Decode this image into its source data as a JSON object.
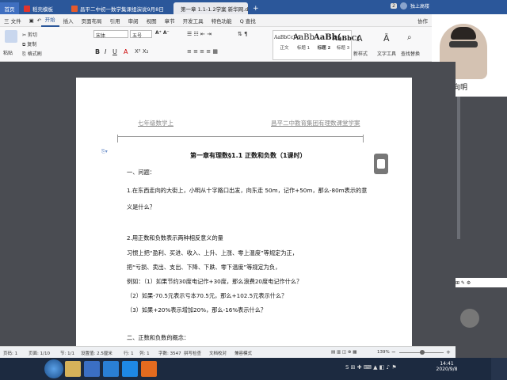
{
  "tabs": {
    "home": "首页",
    "template": "稻壳模板",
    "pdf": "昌平二中初一数学集课组演说9月8日",
    "doc": "第一章 1.1-1.2学案 新华网.docx",
    "add": "+"
  },
  "user": {
    "name": "独上高楼",
    "badge": "2"
  },
  "menu": [
    "三 文件",
    "开始",
    "插入",
    "页面布局",
    "引用",
    "审阅",
    "视图",
    "章节",
    "开发工具",
    "特色功能",
    "Q 查找"
  ],
  "menu_right": [
    "协作"
  ],
  "toolbar": {
    "paste": "粘贴",
    "cut": "剪切",
    "copy": "复制",
    "format_painter": "格式刷",
    "font_name": "宋体",
    "font_size": "五号",
    "styles": [
      {
        "preview": "AaBbCcDd",
        "label": "正文"
      },
      {
        "preview": "AaBb",
        "label": "标题 1"
      },
      {
        "preview": "AaBb(",
        "label": "标题 2"
      },
      {
        "preview": "AaBbC(",
        "label": "标题 3"
      }
    ],
    "new_style": "新样式",
    "text_tools": "文字工具",
    "find_replace": "查找替换"
  },
  "video": {
    "presenter": "彭向明"
  },
  "document": {
    "header_left": "七年级数学上",
    "header_right": "昌平二中教育集团有理数课堂学案",
    "title": "第一章有理数§1.1 正数和负数（1课时）",
    "lines": [
      "一、问题：",
      "1.在东西走向的大街上，小明从十字路口出发，向东走 50m，记作+50m，那么-80m表示的意",
      "义是什么？",
      "",
      "2.用正数和负数表示两种相反意义的量",
      "习惯上把“盈利、买进、收入、上升、上涨、零上温度”等规定为正，",
      "把“亏损、卖出、支出、下降、下跌、零下温度”等规定为负，",
      "例如：（1）如果节约30度电记作+30度，那么浪费20度电记作什么？",
      "（2）如果-70.5元表示亏本70.5元，那么+102.5元表示什么？",
      "（3）如果+20%表示增加20%，那么-16%表示什么？",
      "",
      "二、正数和负数的概念："
    ]
  },
  "status": {
    "page": "页码: 1",
    "pages": "页面: 1/10",
    "section": "节: 1/1",
    "setting": "设置值: 2.5厘米",
    "row": "行: 1",
    "col": "列: 1",
    "wordcount": "字数: 3547",
    "spell": "拼写检查",
    "proof": "文档校对",
    "protect": "兼容模式",
    "zoom": "139%"
  },
  "clock": {
    "time": "14:41",
    "date": "2020/9/8"
  },
  "ime": "中"
}
